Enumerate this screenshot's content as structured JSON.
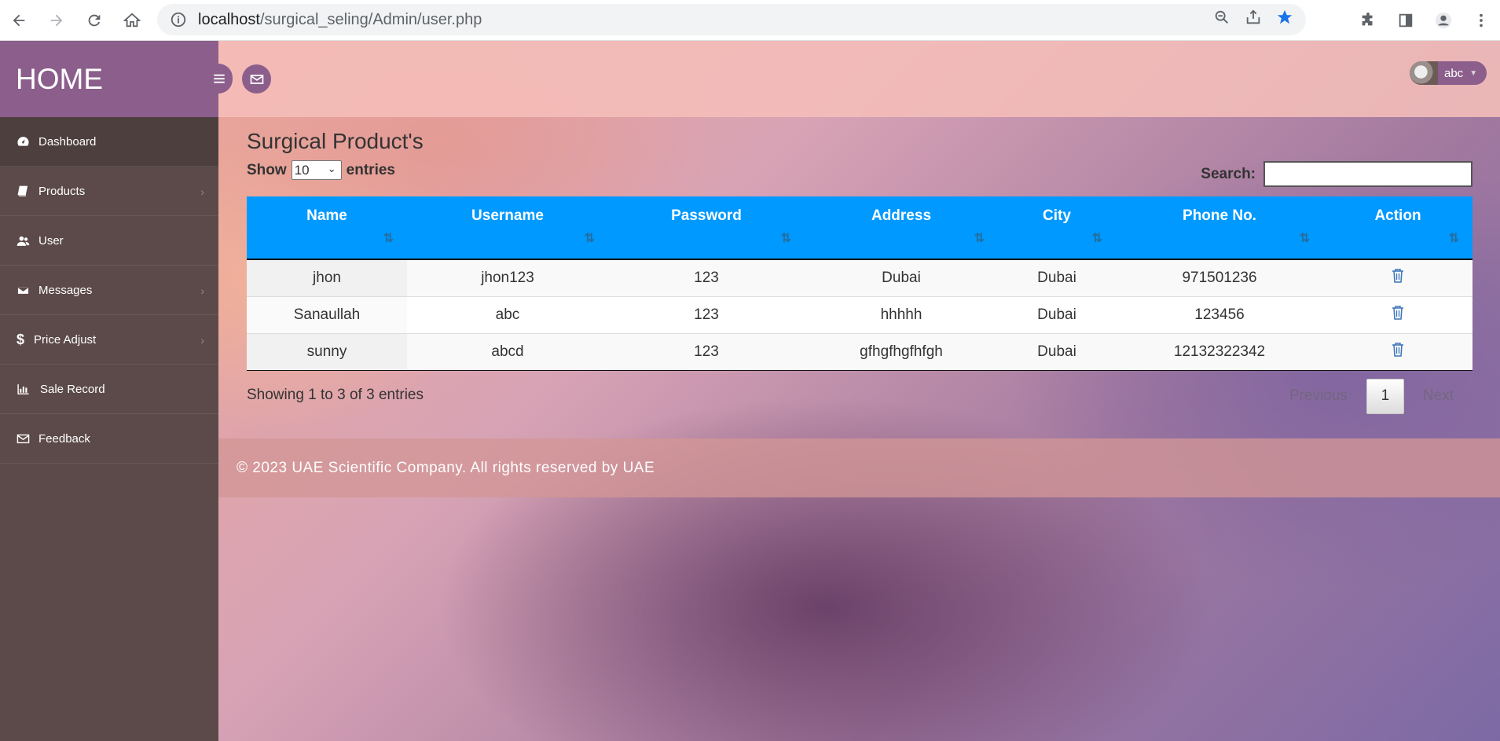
{
  "browser": {
    "url_host": "localhost",
    "url_path": "/surgical_seling/Admin/user.php"
  },
  "sidebar": {
    "brand": "HOME",
    "items": [
      {
        "label": "Dashboard",
        "icon": "dashboard-icon"
      },
      {
        "label": "Products",
        "icon": "book-icon"
      },
      {
        "label": "User",
        "icon": "users-icon"
      },
      {
        "label": "Messages",
        "icon": "envelope-icon"
      },
      {
        "label": "Price Adjust",
        "icon": "dollar-icon"
      },
      {
        "label": "Sale Record",
        "icon": "bar-chart-icon"
      },
      {
        "label": "Feedback",
        "icon": "envelope-outline-icon"
      }
    ]
  },
  "topbar": {
    "user_name": "abc"
  },
  "main": {
    "title": "Surgical Product's",
    "length": {
      "show": "Show",
      "value": "10",
      "entries": "entries"
    },
    "search_label": "Search:",
    "table": {
      "headers": [
        "Name",
        "Username",
        "Password",
        "Address",
        "City",
        "Phone No.",
        "Action"
      ],
      "rows": [
        [
          "jhon",
          "jhon123",
          "123",
          "Dubai",
          "Dubai",
          "971501236"
        ],
        [
          "Sanaullah",
          "abc",
          "123",
          "hhhhh",
          "Dubai",
          "123456"
        ],
        [
          "sunny",
          "abcd",
          "123",
          "gfhgfhgfhfgh",
          "Dubai",
          "12132322342"
        ]
      ]
    },
    "info": "Showing 1 to 3 of 3 entries",
    "pagination": {
      "previous": "Previous",
      "current": "1",
      "next": "Next"
    }
  },
  "footer": {
    "text": "© 2023 UAE Scientific Company. All rights reserved by UAE"
  },
  "colors": {
    "sidebar": "#5c4a4a",
    "brand": "#8b5e8b",
    "table_header": "#0099ff",
    "delete_icon": "#3a73b8"
  }
}
